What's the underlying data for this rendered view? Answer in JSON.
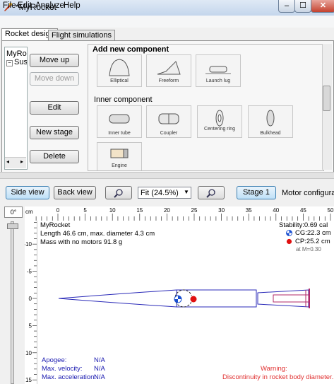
{
  "window": {
    "title": "*MyRocket",
    "minimize": "–",
    "maximize": "☐",
    "close": "✕"
  },
  "menu": [
    "File",
    "Edit",
    "Analyze",
    "Help"
  ],
  "tabs": [
    "Rocket design",
    "Flight simulations"
  ],
  "tree": {
    "root": "MyRocket",
    "child": "Sustainer"
  },
  "side_buttons": {
    "move_up": "Move up",
    "move_down": "Move down",
    "edit": "Edit",
    "new_stage": "New stage",
    "delete": "Delete"
  },
  "add_component": {
    "title": "Add new component",
    "body_row": [
      "Elliptical",
      "Freeform",
      "Launch lug"
    ],
    "inner_title": "Inner component",
    "inner_row": [
      "Inner tube",
      "Coupler",
      "Centering ring",
      "Bulkhead"
    ],
    "mass_row": [
      "Engine"
    ]
  },
  "toolbar": {
    "side_view": "Side view",
    "back_view": "Back view",
    "zoom": "Fit (24.5%)",
    "stage": "Stage 1",
    "motor_config": "Motor configuratio"
  },
  "ruler": {
    "unit": "cm",
    "angle": "0°",
    "top_ticks": [
      "0",
      "5",
      "10",
      "15",
      "20",
      "25",
      "30",
      "35",
      "40",
      "45",
      "50"
    ],
    "left_ticks": [
      "-10",
      "-5",
      "0",
      "5",
      "10",
      "15"
    ]
  },
  "figure": {
    "name": "MyRocket",
    "length": "Length 46.6 cm, max. diameter 4.3 cm",
    "mass": "Mass with no motors 91.8 g",
    "stability": "Stability:0.69 cal",
    "cg": "CG:22.3 cm",
    "cp": "CP:25.2 cm",
    "mach": "at M=0.30",
    "apogee_label": "Apogee:",
    "apogee_value": "N/A",
    "velocity_label": "Max. velocity:",
    "velocity_value": "N/A",
    "accel_label": "Max. acceleration:",
    "accel_value": "N/A",
    "warning_title": "Warning:",
    "warning_text": "Discontinuity in rocket body diameter."
  },
  "colors": {
    "rocket_outline": "#2a2ab8",
    "motor": "#b0286a",
    "warning": "#e03030",
    "cp": "#e01010",
    "cg": "#1a4fd0",
    "info_blue": "#1a1ab0"
  }
}
